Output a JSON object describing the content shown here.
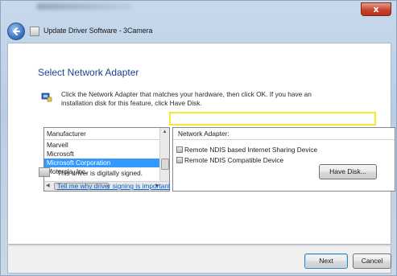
{
  "window": {
    "title": "Update Driver Software - 3Camera"
  },
  "heading": "Select Network Adapter",
  "instructions": "Click the Network Adapter that matches your hardware, then click OK. If you have an installation disk for this feature, click Have Disk.",
  "manufacturer_list": {
    "header": "Manufacturer",
    "items": [
      {
        "label": "Marvell",
        "selected": false
      },
      {
        "label": "Microsoft",
        "selected": false
      },
      {
        "label": "Microsoft Corporation",
        "selected": true
      },
      {
        "label": "Motorola, Inc.",
        "selected": false
      }
    ]
  },
  "adapter_list": {
    "header": "Network Adapter:",
    "items": [
      {
        "label": "Remote NDIS based Internet Sharing Device",
        "highlighted": false
      },
      {
        "label": "Remote NDIS Compatible Device",
        "highlighted": true
      }
    ]
  },
  "signature": {
    "text": "This driver is digitally signed.",
    "link": "Tell me why driver signing is important"
  },
  "buttons": {
    "have_disk": "Have Disk...",
    "next": "Next",
    "cancel": "Cancel",
    "close": "x"
  },
  "colors": {
    "heading": "#1d3f8f",
    "selection": "#3399ff",
    "highlight_box": "#f2ea2b",
    "link": "#0a5ec8"
  }
}
